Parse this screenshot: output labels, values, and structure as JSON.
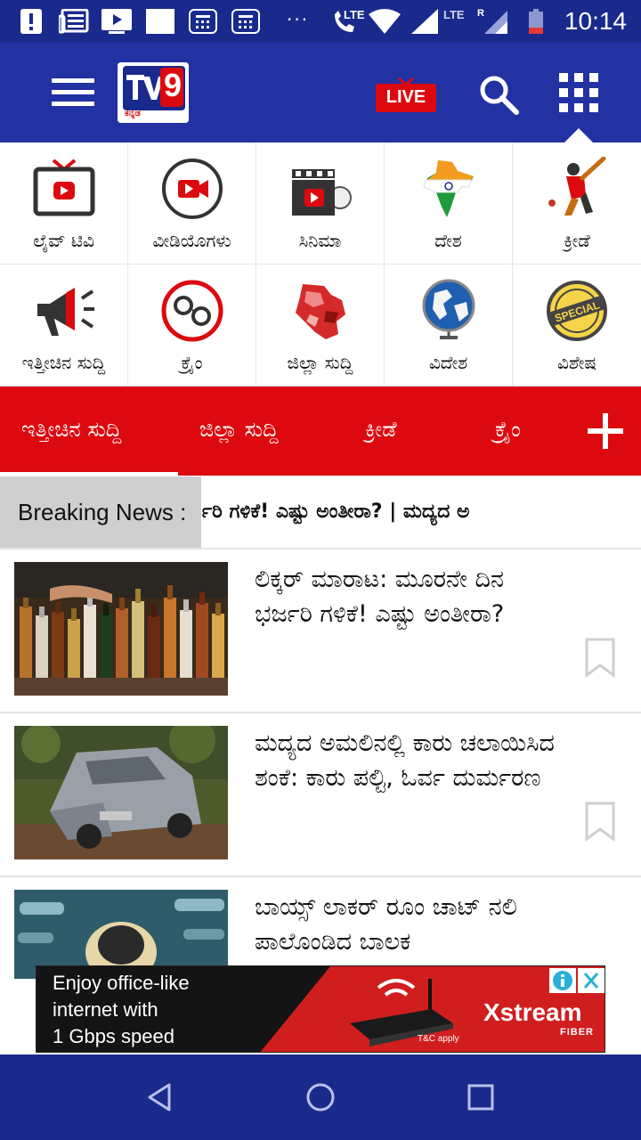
{
  "status_bar": {
    "time": "10:14",
    "network_1": "LTE",
    "network_2": "LTE",
    "roaming": "R",
    "more": "···",
    "colors": {
      "background": "#1a2a8c"
    },
    "icons": [
      "alert-icon",
      "news-icon",
      "tv-play-icon",
      "white-square-icon",
      "calculator-icon",
      "calculator-icon",
      "volte-call-icon",
      "wifi-icon",
      "signal-icon",
      "signal-roaming-icon",
      "battery-low-icon"
    ]
  },
  "header": {
    "logo_text": "9",
    "logo_sub": "ಕನ್ನಡ",
    "live_label": "LIVE",
    "colors": {
      "background": "#2232a3",
      "live": "#dc0a0f"
    }
  },
  "categories": [
    {
      "label": "ಲೈವ್ ಟಿವಿ",
      "icon": "live-tv-icon"
    },
    {
      "label": "ವೀಡಿಯೊಗಳು",
      "icon": "video-camera-icon"
    },
    {
      "label": "ಸಿನಿಮಾ",
      "icon": "cinema-clapper-icon"
    },
    {
      "label": "ದೇಶ",
      "icon": "india-map-icon"
    },
    {
      "label": "ಕ್ರೀಡೆ",
      "icon": "cricket-icon"
    },
    {
      "label": "ಇತ್ತೀಚಿನ ಸುದ್ದಿ",
      "icon": "megaphone-icon"
    },
    {
      "label": "ಕ್ರೈಂ",
      "icon": "handcuffs-icon"
    },
    {
      "label": "ಜಿಲ್ಲಾ ಸುದ್ದಿ",
      "icon": "karnataka-map-icon"
    },
    {
      "label": "ವಿದೇಶ",
      "icon": "globe-icon"
    },
    {
      "label": "ವಿಶೇಷ",
      "icon": "special-badge-icon"
    }
  ],
  "tabs": [
    {
      "label": "ಇತ್ತೀಚಿನ ಸುದ್ದಿ",
      "active": true
    },
    {
      "label": "ಜಿಲ್ಲಾ ಸುದ್ದಿ"
    },
    {
      "label": "ಕ್ರೀಡೆ"
    },
    {
      "label": "ಕ್ರೈಂ"
    }
  ],
  "tab_colors": {
    "background": "#dc0a0f"
  },
  "breaking": {
    "label": "Breaking News :",
    "ticker": "ರ್ಜರಿ ಗಳಿಕೆ! ಎಷ್ಟು ಅಂತೀರಾ? | ಮದ್ಯದ ಅ"
  },
  "news": [
    {
      "title": "ಲಿಕ್ಕರ್ ಮಾರಾಟ: ಮೂರನೇ ದಿನ ಭರ್ಜರಿ ಗಳಿಕೆ! ಎಷ್ಟು ಅಂತೀರಾ?",
      "image": "liquor-bottles"
    },
    {
      "title": "ಮದ್ಯದ ಅಮಲಿನಲ್ಲಿ ಕಾರು ಚಲಾಯಿಸಿದ ಶಂಕೆ: ಕಾರು ಪಲ್ಟಿ, ಓರ್ವ ದುರ್ಮರಣ",
      "image": "crashed-car"
    },
    {
      "title": "ಬಾಯ್ಸ್ ಲಾಕರ್ ರೂಂ ಚಾಟ್ ನಲಿ ಪಾಲೊಂಡಿದ ಬಾಲಕ",
      "image": "chat-screen"
    }
  ],
  "ad": {
    "line1": "Enjoy office-like",
    "line2": "internet with",
    "line3": "1 Gbps speed",
    "brand": "Xstream",
    "brand_sub": "FIBER",
    "tc": "T&C apply",
    "info_icon": "info-icon",
    "close_icon": "close-icon"
  },
  "navbar": {
    "icons": [
      "back-icon",
      "home-icon",
      "recents-icon"
    ]
  }
}
